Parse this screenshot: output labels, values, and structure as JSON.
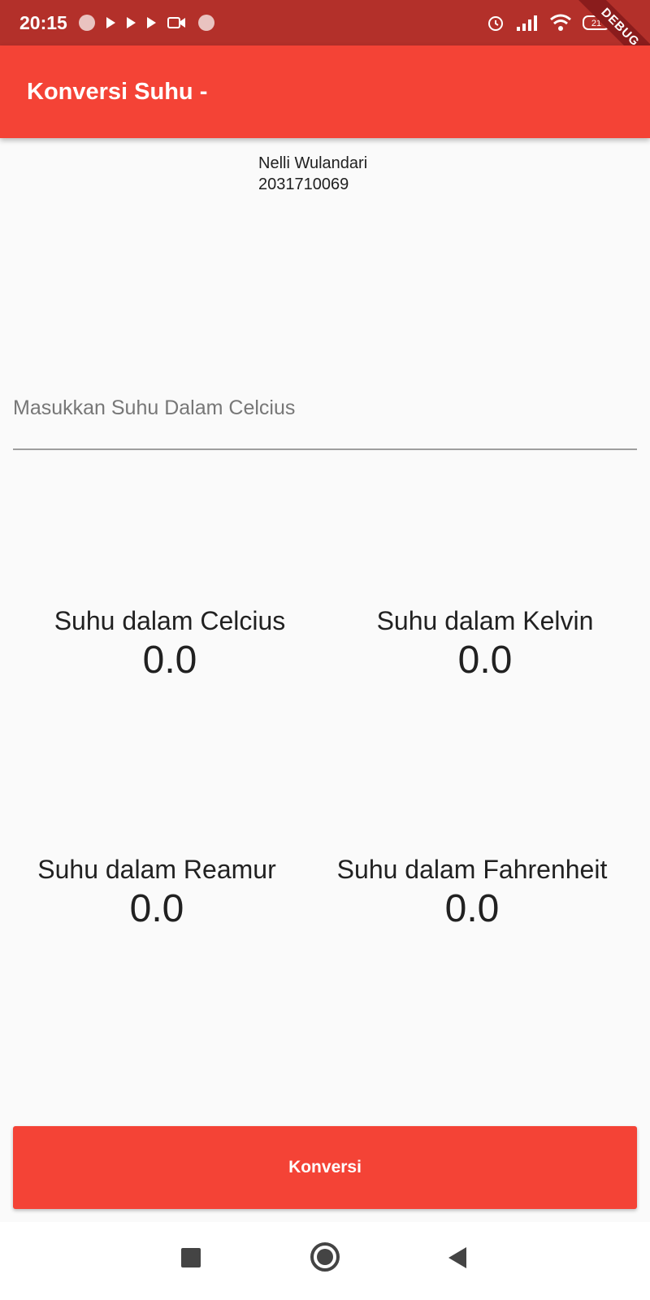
{
  "status_bar": {
    "time": "20:15",
    "battery_level": "21"
  },
  "debug_banner": "DEBUG",
  "app_bar": {
    "title": "Konversi Suhu -"
  },
  "identity": {
    "name": "Nelli Wulandari",
    "nim": "2031710069"
  },
  "input": {
    "placeholder": "Masukkan Suhu Dalam Celcius",
    "value": ""
  },
  "results": [
    {
      "label": "Suhu dalam Celcius",
      "value": "0.0"
    },
    {
      "label": "Suhu dalam Kelvin",
      "value": "0.0"
    },
    {
      "label": "Suhu dalam Reamur",
      "value": "0.0"
    },
    {
      "label": "Suhu dalam Fahrenheit",
      "value": "0.0"
    }
  ],
  "button": {
    "label": "Konversi"
  },
  "colors": {
    "primary": "#f44336",
    "status_bar": "#b3302a",
    "background": "#fafafa"
  },
  "nav_icons": [
    "recents-icon",
    "home-icon",
    "back-icon"
  ]
}
